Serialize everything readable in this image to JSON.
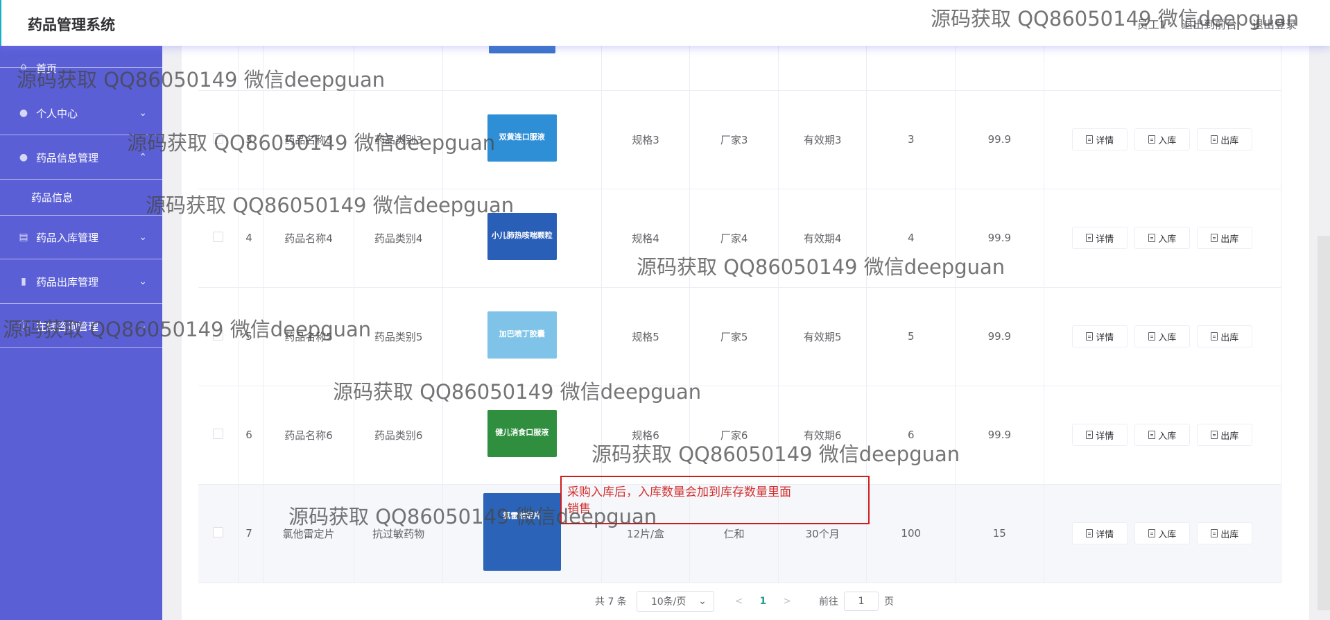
{
  "header": {
    "app_title": "药品管理系统",
    "user_role": "员工1",
    "back_to_front": "退出到前台",
    "logout": "退出登录"
  },
  "sidebar": {
    "items": [
      {
        "label": "首页",
        "icon": "home-icon"
      },
      {
        "label": "个人中心",
        "icon": "user-icon",
        "expanded": false
      },
      {
        "label": "药品信息管理",
        "icon": "user-icon",
        "expanded": true
      },
      {
        "label": "药品信息"
      },
      {
        "label": "药品入库管理",
        "icon": "chat-icon",
        "expanded": false
      },
      {
        "label": "药品出库管理",
        "icon": "bar-chart-icon",
        "expanded": false
      },
      {
        "label": "在线咨询管理",
        "icon": "info-icon",
        "expanded": false
      }
    ]
  },
  "table": {
    "rows": [
      {
        "idx": "3",
        "name": "药品名称3",
        "category": "药品类别3",
        "image_label": "双黄连口服液",
        "spec": "规格3",
        "factory": "厂家3",
        "expiry": "有效期3",
        "stock": "3",
        "price": "99.9",
        "image_color": "#2f8fd6"
      },
      {
        "idx": "4",
        "name": "药品名称4",
        "category": "药品类别4",
        "image_label": "小儿肺热咳喘颗粒",
        "spec": "规格4",
        "factory": "厂家4",
        "expiry": "有效期4",
        "stock": "4",
        "price": "99.9",
        "image_color": "#2a5fb8"
      },
      {
        "idx": "5",
        "name": "药品名称5",
        "category": "药品类别5",
        "image_label": "加巴喷丁胶囊",
        "spec": "规格5",
        "factory": "厂家5",
        "expiry": "有效期5",
        "stock": "5",
        "price": "99.9",
        "image_color": "#7fc4e8"
      },
      {
        "idx": "6",
        "name": "药品名称6",
        "category": "药品类别6",
        "image_label": "健儿消食口服液",
        "spec": "规格6",
        "factory": "厂家6",
        "expiry": "有效期6",
        "stock": "6",
        "price": "99.9",
        "image_color": "#2f8f3f"
      },
      {
        "idx": "7",
        "name": "氯他雷定片",
        "category": "抗过敏药物",
        "image_label": "氯雷他定片",
        "spec": "12片/盒",
        "factory": "仁和",
        "expiry": "30个月",
        "stock": "100",
        "price": "15",
        "image_color": "#2a63b8"
      }
    ],
    "actions": {
      "detail": "详情",
      "stock_in": "入库",
      "stock_out": "出库"
    }
  },
  "annotation": {
    "line1": "采购入库后，入库数量会加到库存数量里面",
    "line2": "销售"
  },
  "pagination": {
    "total": "共 7 条",
    "page_size": "10条/页",
    "current_page": "1",
    "goto_label": "前往",
    "goto_value": "1",
    "page_suffix": "页"
  },
  "watermark": {
    "text": "源码获取 QQ86050149 微信deepguan"
  },
  "colors": {
    "sidebar_bg": "#5b5fd6",
    "accent": "#20a08a",
    "annotation": "#cf1c1c"
  }
}
